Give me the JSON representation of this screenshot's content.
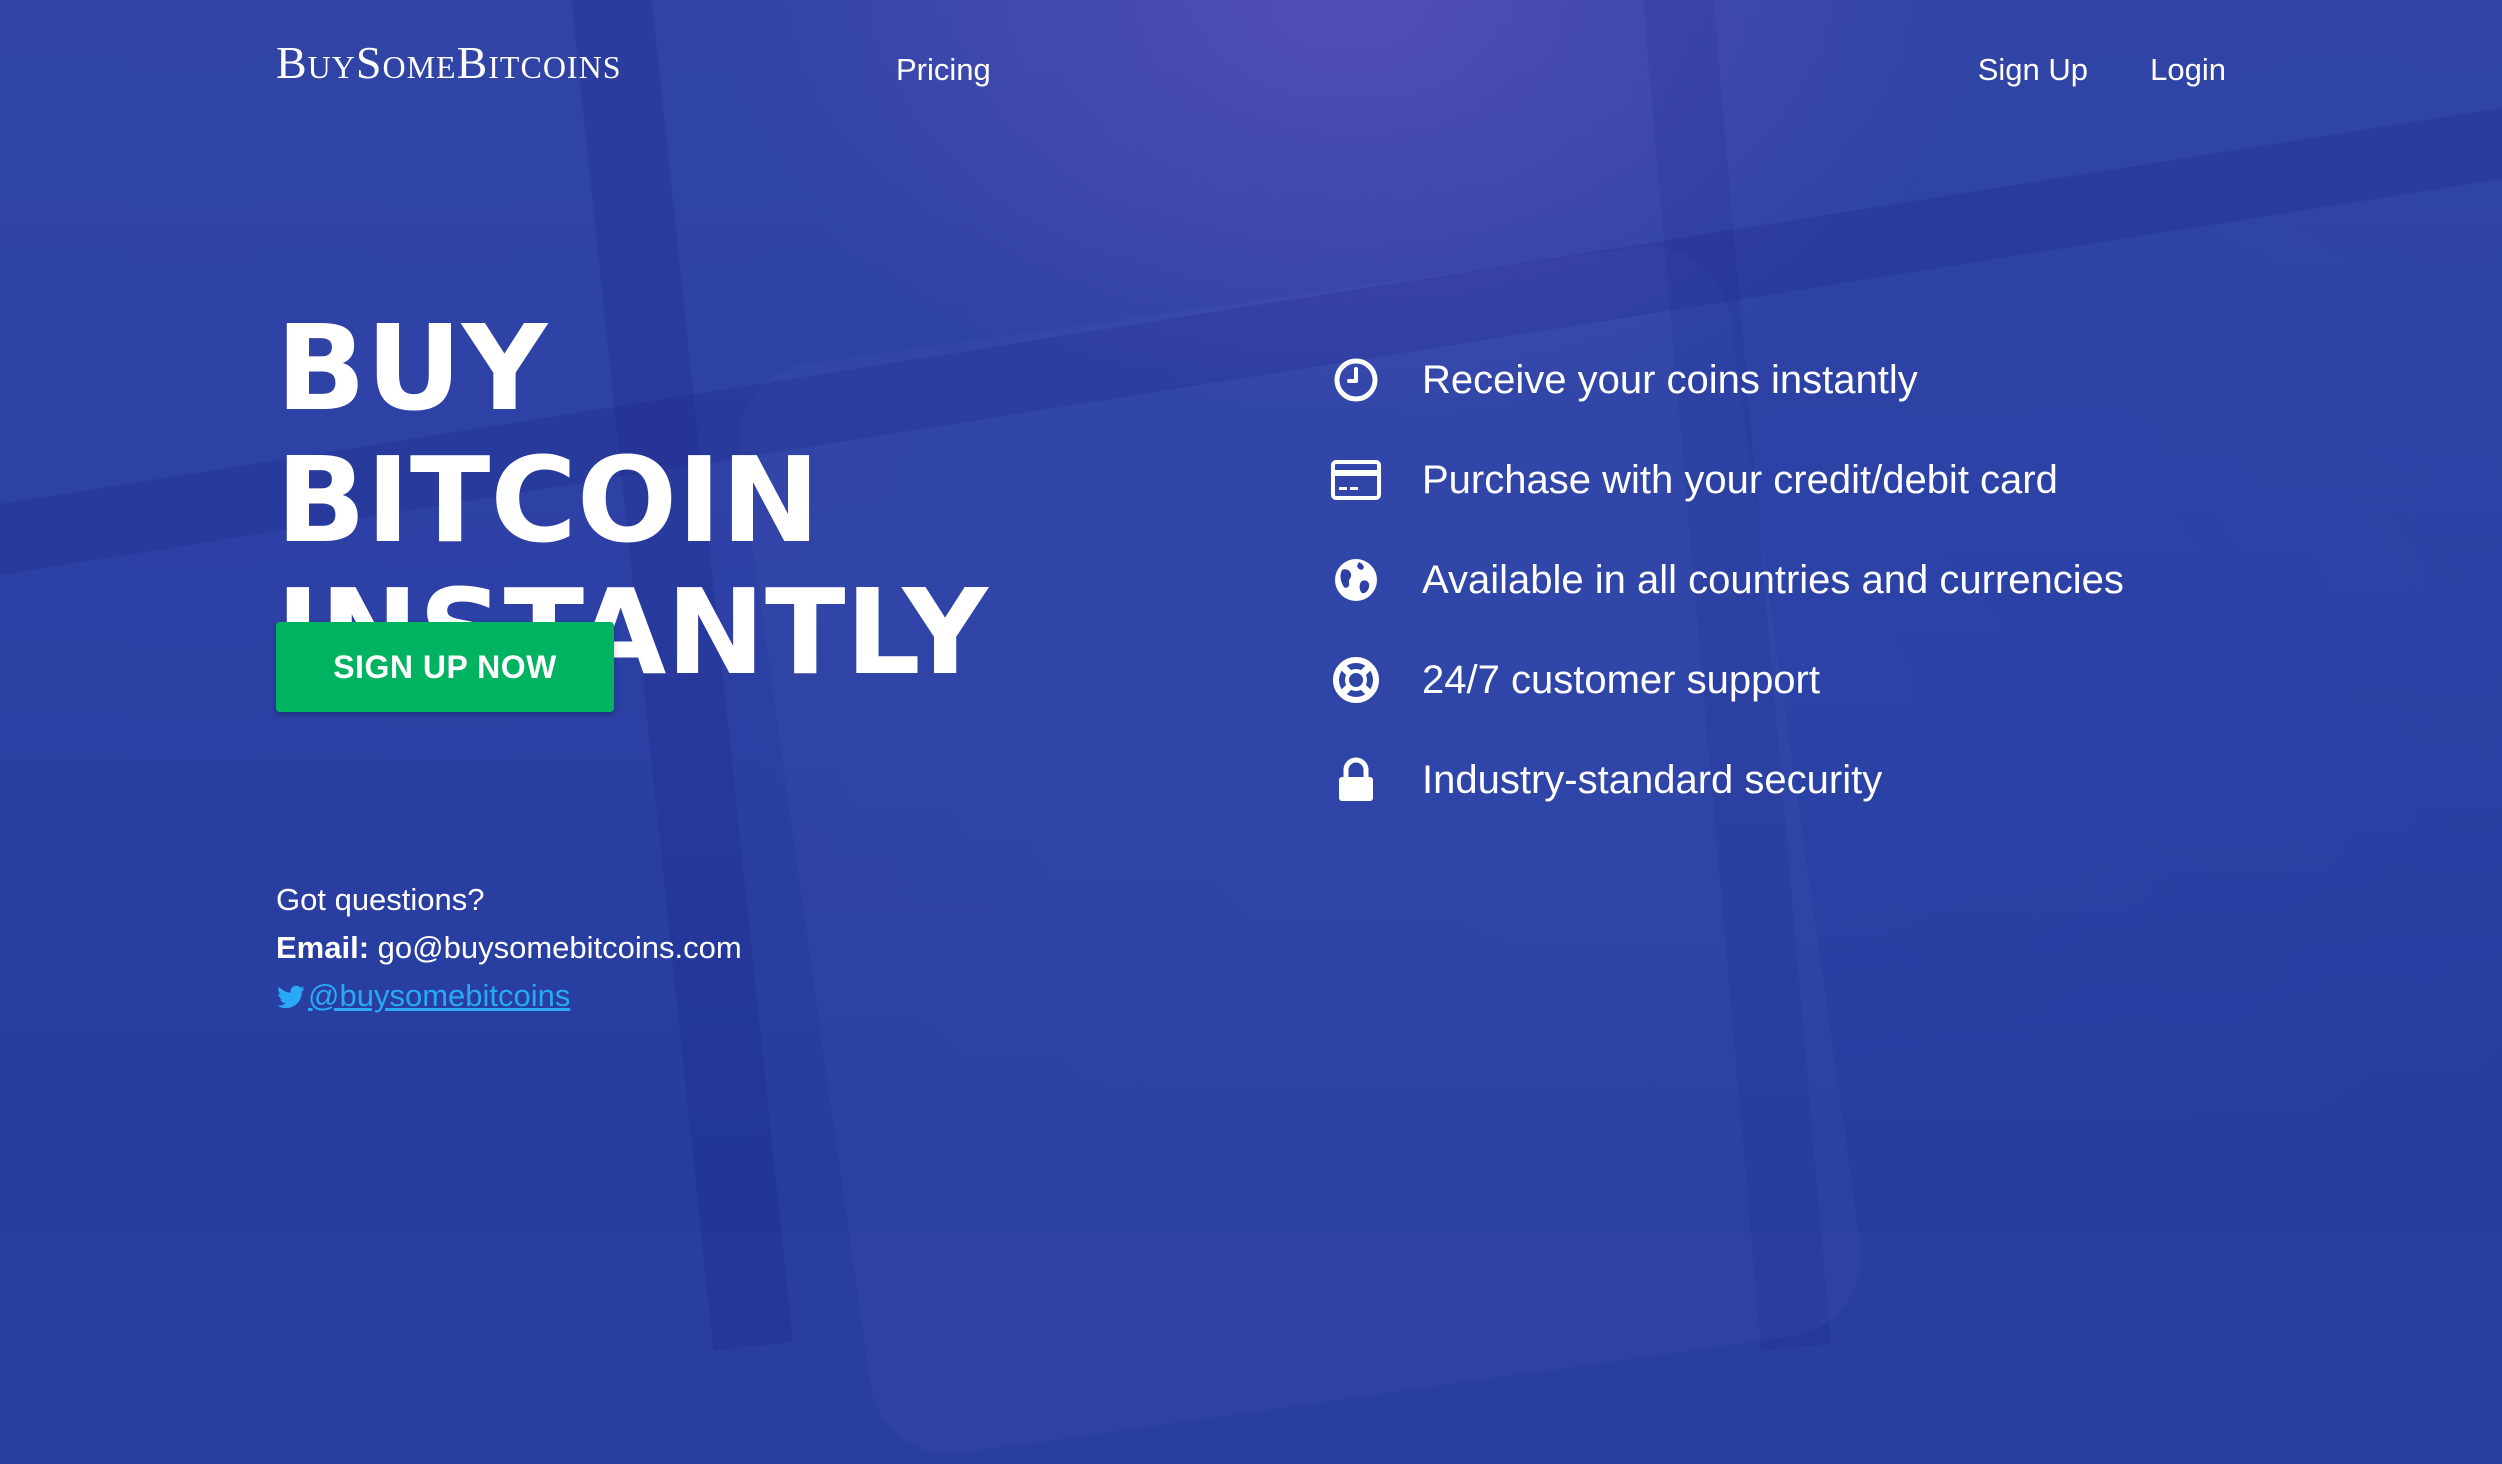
{
  "header": {
    "logo": "BuySomeBitcoins",
    "nav": {
      "pricing": "Pricing",
      "signup": "Sign Up",
      "login": "Login"
    }
  },
  "hero": {
    "title_line1": "BUY BITCOIN",
    "title_line2": "INSTANTLY",
    "cta_label": "SIGN UP NOW"
  },
  "contact": {
    "question": "Got questions?",
    "email_label": "Email:",
    "email_value": "go@buysomebitcoins.com",
    "twitter_handle": "@buysomebitcoins"
  },
  "features": [
    {
      "icon": "clock-icon",
      "text": "Receive your coins instantly"
    },
    {
      "icon": "credit-card-icon",
      "text": "Purchase with your credit/debit card"
    },
    {
      "icon": "globe-icon",
      "text": "Available in all countries and currencies"
    },
    {
      "icon": "life-ring-icon",
      "text": "24/7 customer support"
    },
    {
      "icon": "lock-icon",
      "text": "Industry-standard security"
    }
  ],
  "colors": {
    "background": "#2d40a5",
    "cta": "#00b360",
    "link": "#29a8f5",
    "text": "#ffffff"
  }
}
